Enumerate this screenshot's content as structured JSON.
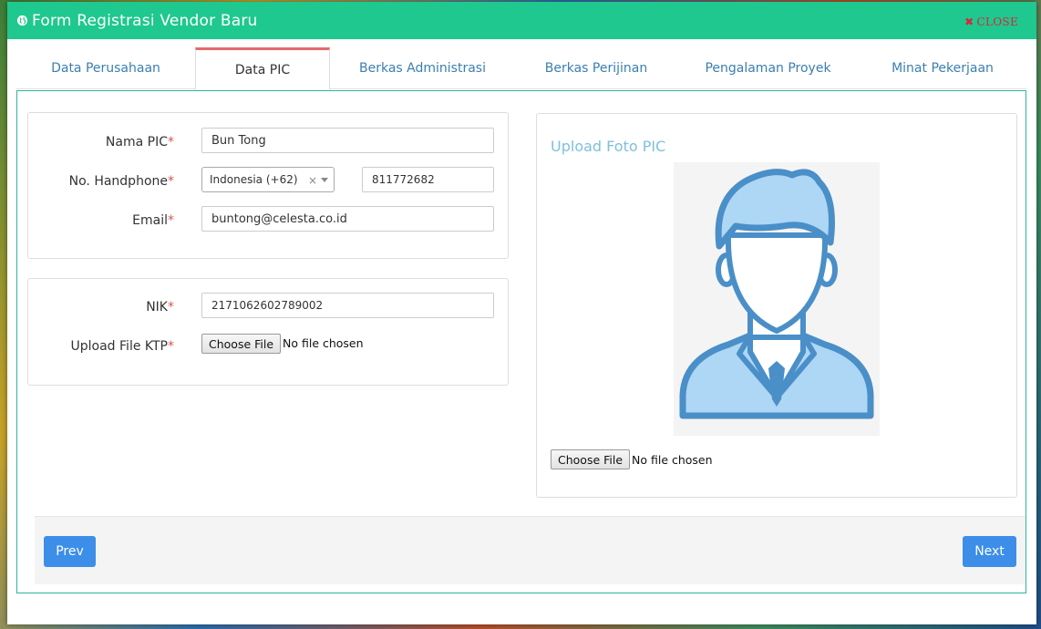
{
  "header": {
    "title": "Form Registrasi Vendor Baru",
    "close_label": "CLOSE"
  },
  "tabs": [
    {
      "label": "Data Perusahaan",
      "active": false
    },
    {
      "label": "Data PIC",
      "active": true
    },
    {
      "label": "Berkas Administrasi",
      "active": false
    },
    {
      "label": "Berkas Perijinan",
      "active": false
    },
    {
      "label": "Pengalaman Proyek",
      "active": false
    },
    {
      "label": "Minat Pekerjaan",
      "active": false
    }
  ],
  "form": {
    "nama_pic": {
      "label": "Nama PIC",
      "value": "Bun Tong"
    },
    "handphone": {
      "label": "No. Handphone",
      "country": "Indonesia (+62)",
      "clear": "×",
      "number": "811772682"
    },
    "email": {
      "label": "Email",
      "value": "buntong@celesta.co.id"
    },
    "nik": {
      "label": "NIK",
      "value": "2171062602789002"
    },
    "ktp": {
      "label": "Upload File KTP",
      "button": "Choose File",
      "status": "No file chosen"
    },
    "required_mark": "*"
  },
  "photo": {
    "title": "Upload Foto PIC",
    "button": "Choose File",
    "status": "No file chosen"
  },
  "footer": {
    "prev_label": "Prev",
    "next_label": "Next"
  },
  "colors": {
    "header": "#1ec88e",
    "accent_tab": "#e46a6f",
    "button": "#3c8ee8",
    "required": "#d9534f",
    "close": "#d7263d"
  }
}
